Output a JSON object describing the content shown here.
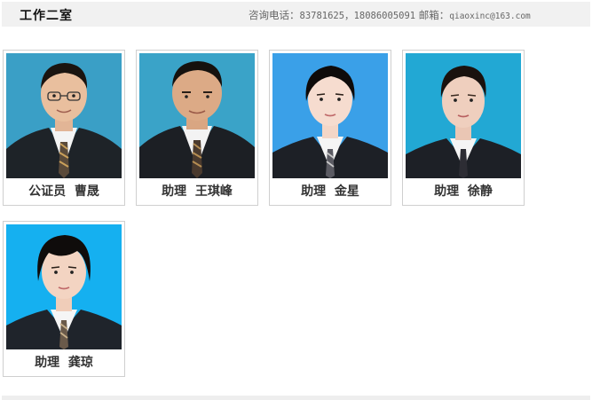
{
  "header": {
    "title": "工作二室",
    "phone_label": "咨询电话：",
    "phone_value": "83781625，18086005091",
    "mail_label": " 邮箱：",
    "mail_value": "qiaoxinc@163.com"
  },
  "staff": [
    {
      "caption": "公证员  曹晟",
      "photo_bg": "#3a9fc6",
      "gender": "male"
    },
    {
      "caption": "助理  王琪峰",
      "photo_bg": "#3aa3c8",
      "gender": "male"
    },
    {
      "caption": "助理  金星",
      "photo_bg": "#3aa0e8",
      "gender": "female"
    },
    {
      "caption": "助理  徐静",
      "photo_bg": "#22a8d4",
      "gender": "female"
    },
    {
      "caption": "助理  龚琼",
      "photo_bg": "#15b0f0",
      "gender": "female"
    }
  ],
  "colors": {
    "header_bg": "#f1f1f1",
    "card_border": "#cfcfcf",
    "caption_text": "#333333"
  }
}
